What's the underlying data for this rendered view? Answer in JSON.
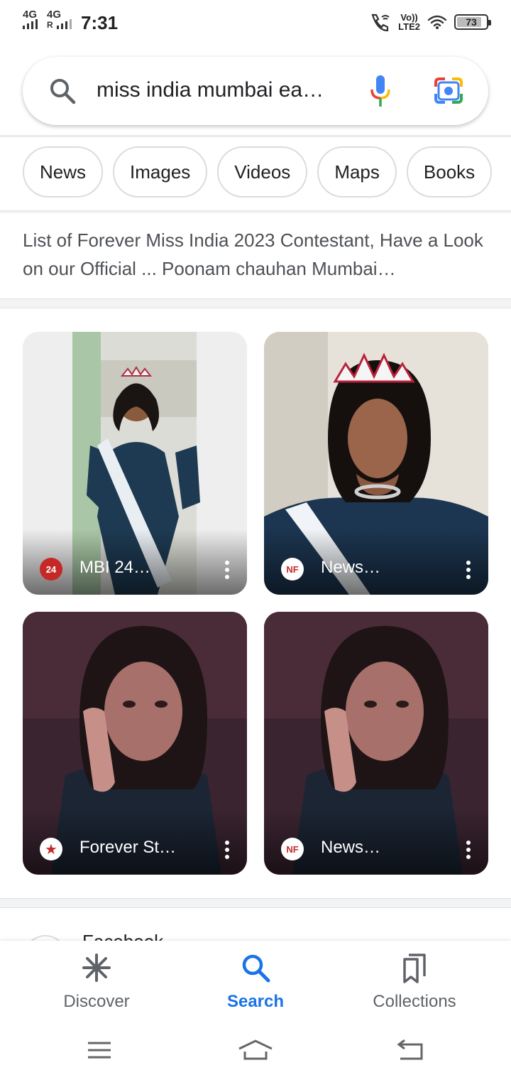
{
  "status_bar": {
    "network1": "4G",
    "network2": "4G",
    "roaming": "R",
    "time": "7:31",
    "volte_top": "Vo))",
    "volte_bottom": "LTE2",
    "battery": "73"
  },
  "search": {
    "query": "miss india mumbai ea…"
  },
  "chips": [
    "News",
    "Images",
    "Videos",
    "Maps",
    "Books"
  ],
  "snippet": "List of Forever Miss India 2023 Contestant, Have a Look on our Official ... Poonam chauhan Mumbai…",
  "images": [
    {
      "source_logo": "24",
      "source": "MBI 24…"
    },
    {
      "source_logo": "NF",
      "source": "News…"
    },
    {
      "source_logo": "★",
      "source": "Forever St…"
    },
    {
      "source_logo": "NF",
      "source": "News…"
    }
  ],
  "next_result_title": "Facebook",
  "bottom_nav": {
    "discover": "Discover",
    "search": "Search",
    "collections": "Collections"
  },
  "colors": {
    "accent": "#1a73e8",
    "chip_border": "#dadce0",
    "text_secondary": "#4d5156"
  }
}
